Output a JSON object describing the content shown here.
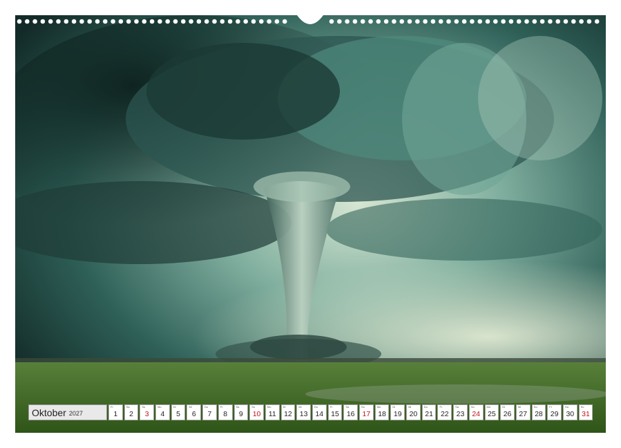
{
  "calendar": {
    "month": "Oktober",
    "year": "2027",
    "days": [
      {
        "wd": "Fr",
        "d": "1"
      },
      {
        "wd": "Sa",
        "d": "2"
      },
      {
        "wd": "So",
        "d": "3",
        "sun": true
      },
      {
        "wd": "Mo",
        "d": "4"
      },
      {
        "wd": "Di",
        "d": "5"
      },
      {
        "wd": "Mi",
        "d": "6"
      },
      {
        "wd": "Do",
        "d": "7"
      },
      {
        "wd": "Fr",
        "d": "8"
      },
      {
        "wd": "Sa",
        "d": "9"
      },
      {
        "wd": "So",
        "d": "10",
        "sun": true
      },
      {
        "wd": "Mo",
        "d": "11"
      },
      {
        "wd": "Di",
        "d": "12"
      },
      {
        "wd": "Mi",
        "d": "13"
      },
      {
        "wd": "Do",
        "d": "14"
      },
      {
        "wd": "Fr",
        "d": "15"
      },
      {
        "wd": "Sa",
        "d": "16"
      },
      {
        "wd": "So",
        "d": "17",
        "sun": true
      },
      {
        "wd": "Mo",
        "d": "18"
      },
      {
        "wd": "Di",
        "d": "19"
      },
      {
        "wd": "Mi",
        "d": "20"
      },
      {
        "wd": "Do",
        "d": "21"
      },
      {
        "wd": "Fr",
        "d": "22"
      },
      {
        "wd": "Sa",
        "d": "23"
      },
      {
        "wd": "So",
        "d": "24",
        "sun": true
      },
      {
        "wd": "Mo",
        "d": "25"
      },
      {
        "wd": "Di",
        "d": "26"
      },
      {
        "wd": "Mi",
        "d": "27"
      },
      {
        "wd": "Do",
        "d": "28"
      },
      {
        "wd": "Fr",
        "d": "29"
      },
      {
        "wd": "Sa",
        "d": "30"
      },
      {
        "wd": "So",
        "d": "31",
        "sun": true
      }
    ]
  },
  "colors": {
    "sky_dark": "#14302c",
    "sky_mid": "#3f7a70",
    "sky_light": "#c9dcc8",
    "field": "#3f6a22",
    "sunday": "#c0141c"
  }
}
